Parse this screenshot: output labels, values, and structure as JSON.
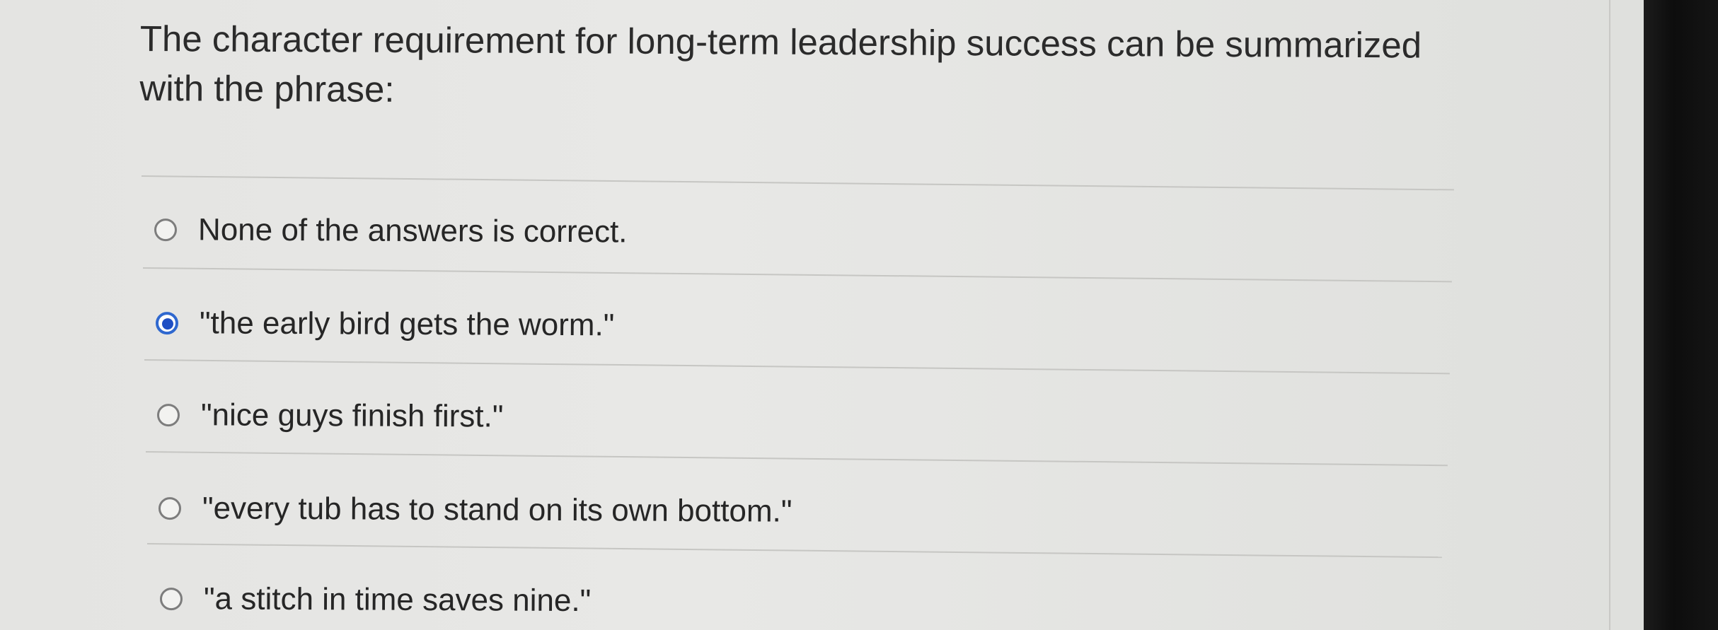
{
  "question": {
    "text": "The character requirement for long-term leadership success can be summarized with the phrase:"
  },
  "options": [
    {
      "label": "None of the answers is correct.",
      "selected": false
    },
    {
      "label": "\"the early bird gets the worm.\"",
      "selected": true
    },
    {
      "label": "\"nice guys finish first.\"",
      "selected": false
    },
    {
      "label": "\"every tub has to stand on its own bottom.\"",
      "selected": false
    },
    {
      "label": "\"a stitch in time saves nine.\"",
      "selected": false
    }
  ],
  "colors": {
    "selected_radio": "#1f4fc4",
    "text": "#262626",
    "divider": "#c6c6c3"
  }
}
